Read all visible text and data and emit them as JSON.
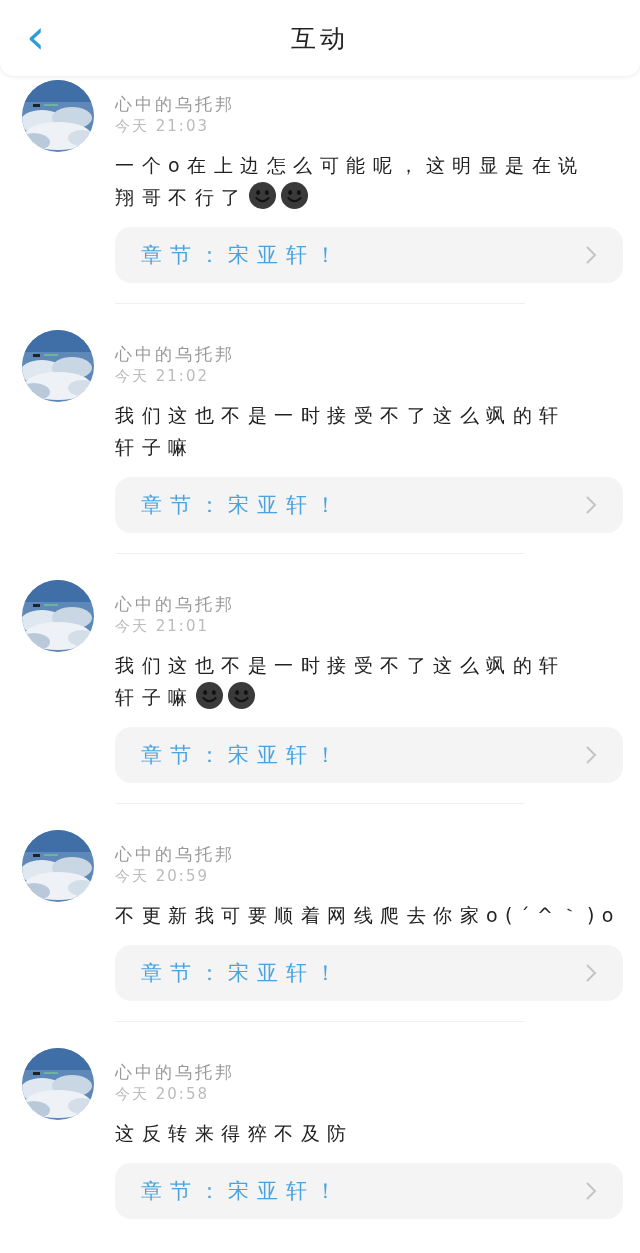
{
  "header": {
    "back": "‹",
    "title": "互动"
  },
  "comments": [
    {
      "user": "心中的乌托邦",
      "time": "今天 21:03",
      "lines": [
        "一个o在上边怎么可能呢，这明显是在说",
        "翔哥不行了"
      ],
      "emoticons": [
        {
          "kind": "smiley"
        },
        {
          "kind": "smiley"
        }
      ],
      "chapter": "章节：宋亚轩！"
    },
    {
      "user": "心中的乌托邦",
      "time": "今天 21:02",
      "lines": [
        "我们这也不是一时接受不了这么飒的轩",
        "轩子嘛"
      ],
      "chapter": "章节：宋亚轩！"
    },
    {
      "user": "心中的乌托邦",
      "time": "今天 21:01",
      "lines": [
        "我们这也不是一时接受不了这么飒的轩",
        "轩子嘛"
      ],
      "emoticons": [
        {
          "kind": "smiley"
        },
        {
          "kind": "smiley"
        }
      ],
      "chapter": "章节：宋亚轩！"
    },
    {
      "user": "心中的乌托邦",
      "time": "今天 20:59",
      "lines": [
        "不更新我可要顺着网线爬去你家o(´^｀)o"
      ],
      "chapter": "章节：宋亚轩！"
    },
    {
      "user": "心中的乌托邦",
      "time": "今天 20:58",
      "lines": [
        "这反转来得猝不及防"
      ],
      "chapter": "章节：宋亚轩！"
    }
  ]
}
